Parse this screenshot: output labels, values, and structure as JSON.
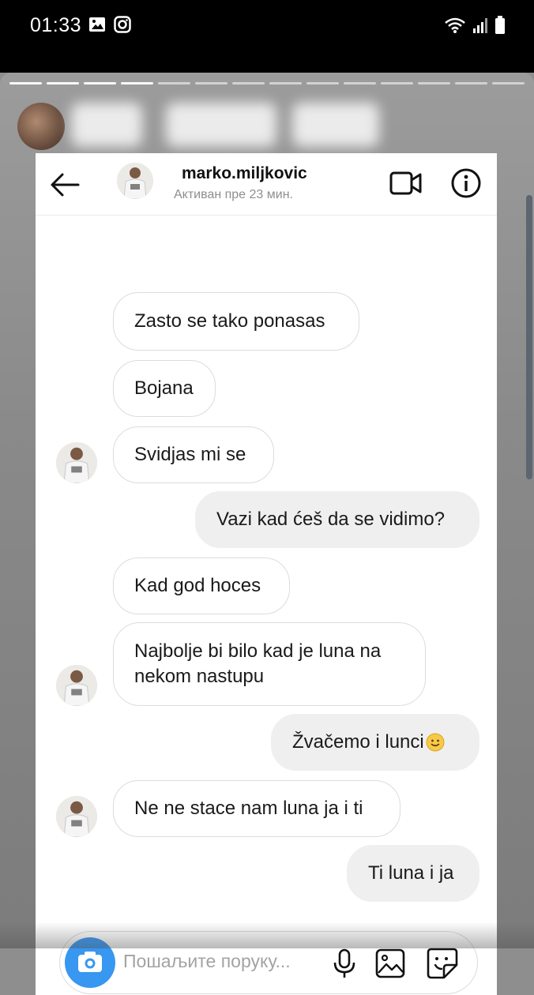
{
  "status_bar": {
    "time": "01:33",
    "icons": [
      "image-icon",
      "instagram-icon",
      "wifi-icon",
      "signal-icon",
      "battery-icon"
    ]
  },
  "chat": {
    "username": "marko.miljkovic",
    "active_status": "Активан пре 23 мин.",
    "messages": [
      {
        "side": "in",
        "text": "Zasto se tako ponasas"
      },
      {
        "side": "in",
        "text": "Bojana"
      },
      {
        "side": "in",
        "text": "Svidjas mi se"
      },
      {
        "side": "out",
        "text": "Vazi kad ćeš da se vidimo?"
      },
      {
        "side": "in",
        "text": "Kad god hoces"
      },
      {
        "side": "in",
        "text": "Najbolje bi bilo kad je luna na nekom nastupu"
      },
      {
        "side": "out",
        "text": "Žvačemo i lunci"
      },
      {
        "side": "in",
        "text": "Ne ne stace nam luna ja i ti"
      },
      {
        "side": "out",
        "text": "Ti luna i ja"
      }
    ],
    "emoji_icon": "slightly-smiling-face-icon",
    "composer": {
      "placeholder": "Пошаљите поруку..."
    }
  },
  "colors": {
    "accent": "#3897f0",
    "incoming_bubble_border": "#dcdcdc",
    "outgoing_bubble_bg": "#efefef"
  }
}
